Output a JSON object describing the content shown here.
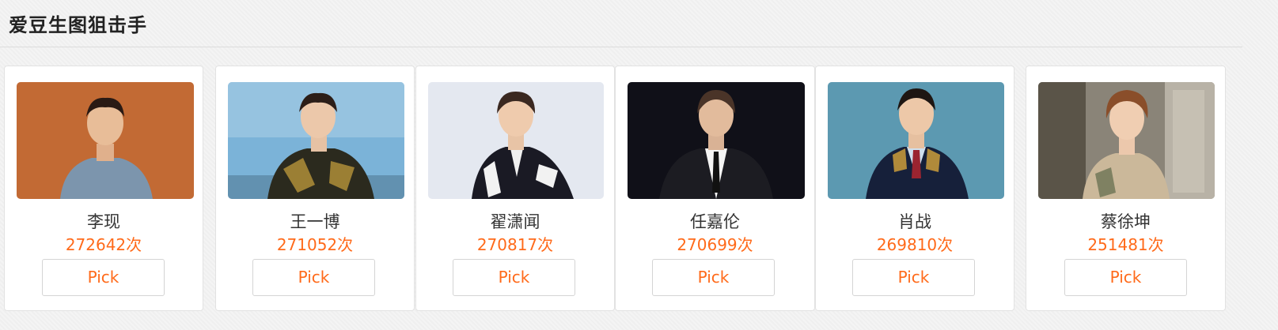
{
  "page": {
    "title": "爱豆生图狙击手"
  },
  "idols": [
    {
      "name": "李现",
      "count": "272642次",
      "button": "Pick",
      "photo_bg": "#c8703a"
    },
    {
      "name": "王一博",
      "count": "271052次",
      "button": "Pick",
      "photo_bg": "#7bb3d8"
    },
    {
      "name": "翟潇闻",
      "count": "270817次",
      "button": "Pick",
      "photo_bg": "#e4e8f0"
    },
    {
      "name": "任嘉伦",
      "count": "270699次",
      "button": "Pick",
      "photo_bg": "#101018"
    },
    {
      "name": "肖战",
      "count": "269810次",
      "button": "Pick",
      "photo_bg": "#4f8ea8"
    },
    {
      "name": "蔡徐坤",
      "count": "251481次",
      "button": "Pick",
      "photo_bg": "#8a8478"
    }
  ],
  "colors": {
    "accent": "#ff6a1a",
    "title": "#222222"
  }
}
